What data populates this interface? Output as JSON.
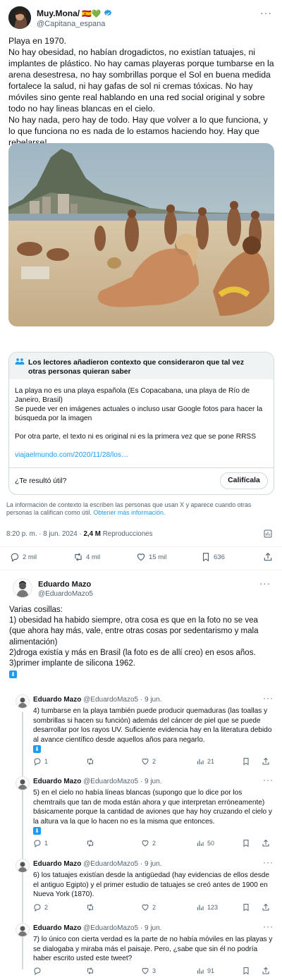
{
  "tweet": {
    "author_name": "Muy.Mona/",
    "author_emojis": "🇪🇸💚",
    "handle": "@Capitana_espana",
    "text": "Playa en 1970.\nNo hay obesidad, no habían drogadictos, no existían tatuajes, ni implantes de plástico. No hay camas playeras porque tumbarse en la arena desestresa, no hay sombrillas porque el Sol en buena medida fortalece la salud, ni hay gafas de sol ni cremas tóxicas. No hay móviles sino gente real hablando en una red social original y sobre todo no hay lineas blancas en el cielo.\nNo hay nada, pero hay de todo. Hay que volver a lo que funciona, y lo que funciona no es nada de lo estamos haciendo hoy. Hay que rebelarse!",
    "time": "8:20 p. m. · 8 jun. 2024 · ",
    "views": "2,4 M",
    "views_label": " Reproducciones",
    "stats": {
      "replies": "2 mil",
      "retweets": "4 mil",
      "likes": "15 mil",
      "bookmarks": "636"
    }
  },
  "community_note": {
    "title": "Los lectores añadieron contexto que consideraron que tal vez otras personas quieran saber",
    "body": "La playa no es una playa española (Es Copacabana, una playa de Río de Janeiro, Brasil)\nSe puede ver en imágenes actuales o incluso usar Google fotos para hacer la búsqueda por la imagen\n\nPor otra parte, el texto ni es original ni es la primera vez que se pone RRSS",
    "link": "viajaelmundo.com/2020/11/28/los…",
    "helpful_question": "¿Te resultó útil?",
    "rate_button": "Califícala"
  },
  "disclaimer": {
    "text": "La información de contexto la escriben las personas que usan X y aparece cuando otras personas la califican como útil. ",
    "more_info": "Obtener más información."
  },
  "reply": {
    "name": "Eduardo Mazo",
    "handle": "@EduardoMazo5",
    "text": "Varias cosillas:\n1) obesidad ha habido siempre, otra cosa es que en la foto no se vea (que ahora hay más, vale, entre otras cosas por sedentarismo y mala alimentación)\n2)droga existía y más en Brasil (la foto es de allí creo) en esos años.\n3)primer implante de silicona 1962."
  },
  "thread": [
    {
      "name": "Eduardo Mazo",
      "meta": " @EduardoMazo5 · 9 jun.",
      "text": "4) tumbarse en la playa también puede producir quemaduras (las toallas y sombrillas si hacen su función) además del cáncer de piel que se puede desarrollar por los rayos UV. Suficiente evidencia hay en la literatura debido al avance científico desde aquellos años para negarlo.",
      "replies": "1",
      "retweets": "",
      "likes": "2",
      "views": "21"
    },
    {
      "name": "Eduardo Mazo",
      "meta": " @EduardoMazo5 · 9 jun.",
      "text": "5) en el cielo no había líneas blancas (supongo que lo dice por los chemtrails que tan de moda están ahora y que interpretan erróneamente) básicamente porque la cantidad de aviones que hay hoy cruzando el cielo y la altura va la que lo hacen no es la misma que entonces.",
      "replies": "1",
      "retweets": "",
      "likes": "2",
      "views": "50"
    },
    {
      "name": "Eduardo Mazo",
      "meta": " @EduardoMazo5 · 9 jun.",
      "text": "6) los tatuajes existían desde la antigüedad (hay evidencias de ellos desde el antiguo Egipto) y el primer estudio de tatuajes se creó antes de 1900 en Nueva York (1870).",
      "replies": "2",
      "retweets": "",
      "likes": "2",
      "views": "123"
    },
    {
      "name": "Eduardo Mazo",
      "meta": " @EduardoMazo5 · 9 jun.",
      "text": "7) lo único con cierta verdad es la parte de no había móviles en las playas y se dialogaba y miraba más el paisaje. Pero, ¿sabe que sin él no podría haber escrito usted este tweet?",
      "replies": "",
      "retweets": "",
      "likes": "3",
      "views": "91"
    }
  ],
  "icons": {
    "verified": "verified-badge-icon",
    "reply": "reply-icon",
    "retweet": "retweet-icon",
    "like": "heart-icon",
    "bookmark": "bookmark-icon",
    "share": "share-icon",
    "views": "views-icon",
    "more": "more-icon",
    "blue_arrow": "blue-down-arrow-icon"
  },
  "colors": {
    "accent": "#1d9bf0",
    "muted": "#536471",
    "border": "#cfd9de",
    "note_header": "#eff3f4"
  }
}
